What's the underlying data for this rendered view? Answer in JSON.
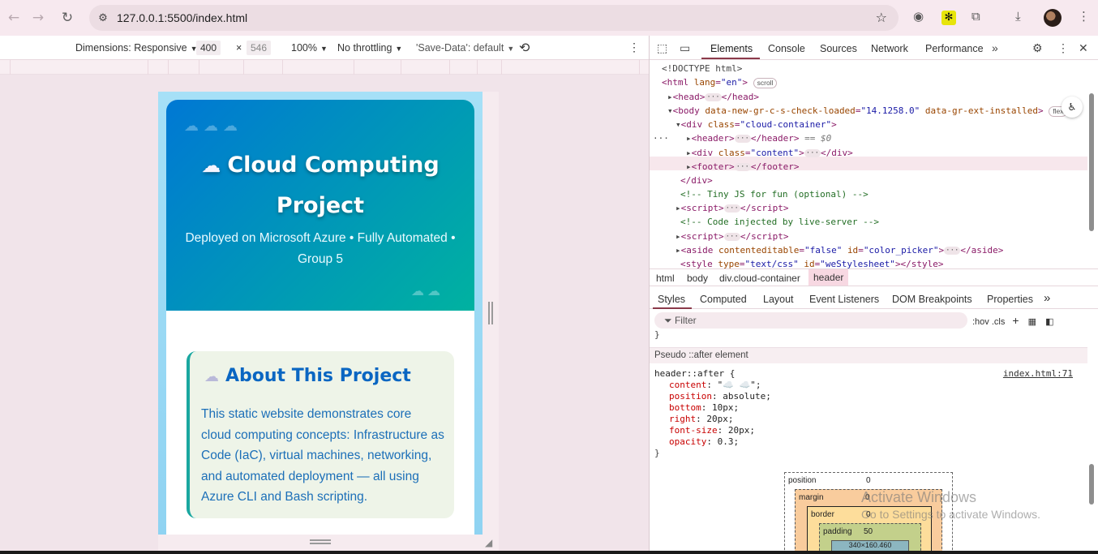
{
  "browser": {
    "url": "127.0.0.1:5500/index.html"
  },
  "device_toolbar": {
    "dimensions_label": "Dimensions: Responsive",
    "width": "400",
    "height": "546",
    "times": "×",
    "zoom": "100%",
    "throttling": "No throttling",
    "save_data": "'Save-Data': default"
  },
  "page": {
    "hero_title_line1": "Cloud Computing",
    "hero_title_line2": "Project",
    "hero_subtitle": "Deployed on Microsoft Azure • Fully Automated • Group 5",
    "about_title": "About This Project",
    "about_text": "This static website demonstrates core cloud computing concepts: Infrastructure as Code (IaC), virtual machines, networking, and automated deployment — all using Azure CLI and Bash scripting."
  },
  "devtools": {
    "tabs": [
      "Elements",
      "Console",
      "Sources",
      "Network",
      "Performance"
    ],
    "dom": {
      "doctype": "<!DOCTYPE html>",
      "html_open": "<html",
      "lang_attr": "lang",
      "lang_val": "\"en\"",
      "scroll_badge": "scroll",
      "head": "head",
      "body_attr1": "data-new-gr-c-s-check-loaded",
      "body_val1": "\"14.1258.0\"",
      "body_attr2": "data-gr-ext-installed",
      "flex_badge": "flex",
      "div_class": "\"cloud-container\"",
      "header_marker": "== $0",
      "content_class": "\"content\"",
      "comment1": "<!-- Tiny JS for fun (optional) -->",
      "comment2": "<!-- Code injected by live-server -->",
      "aside_attr1": "contenteditable",
      "aside_val1": "\"false\"",
      "aside_attr2": "id",
      "aside_val2": "\"color_picker\"",
      "style_attr1": "type",
      "style_val1": "\"text/css\"",
      "style_attr2": "id",
      "style_val2": "\"weStylesheet\""
    },
    "breadcrumbs": [
      "html",
      "body",
      "div.cloud-container",
      "header"
    ],
    "style_tabs": [
      "Styles",
      "Computed",
      "Layout",
      "Event Listeners",
      "DOM Breakpoints",
      "Properties"
    ],
    "filter_placeholder": "Filter",
    "filter_tools": ":hov  .cls",
    "pseudo_header": "Pseudo ::after element",
    "rule_selector": "header::after {",
    "rule_source": "index.html:71",
    "rule_props": [
      {
        "name": "content",
        "value": "\"☁️ ☁️\";"
      },
      {
        "name": "position",
        "value": "absolute;"
      },
      {
        "name": "bottom",
        "value": "10px;"
      },
      {
        "name": "right",
        "value": "20px;"
      },
      {
        "name": "font-size",
        "value": "20px;"
      },
      {
        "name": "opacity",
        "value": "0.3;"
      }
    ],
    "box_model": {
      "position_label": "position",
      "position_value": "0",
      "margin_label": "margin",
      "margin_value": "0",
      "border_label": "border",
      "border_value": "0",
      "padding_label": "padding",
      "padding_value": "50",
      "content_size": "340×160.460"
    }
  },
  "watermark": {
    "line1": "Activate Windows",
    "line2": "Go to Settings to activate Windows."
  }
}
